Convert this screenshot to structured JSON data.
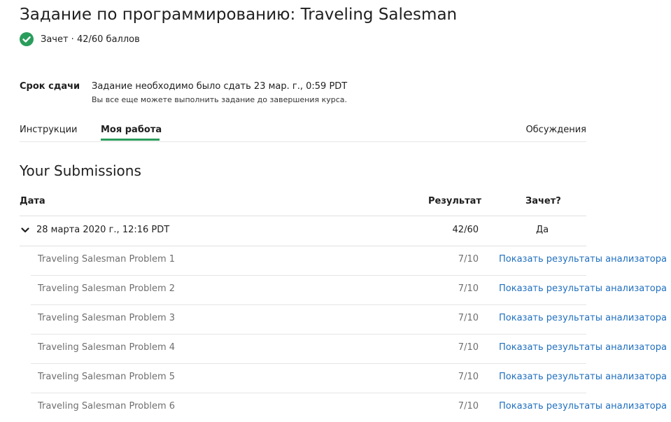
{
  "page_title": "Задание по программированию: Traveling Salesman",
  "status": {
    "text": "Зачет · 42/60 баллов",
    "color": "#2a9d5c"
  },
  "deadline": {
    "label": "Срок сдачи",
    "text": "Задание необходимо было сдать 23 мар. г., 0:59 PDT",
    "subtext": "Вы все еще можете выполнить задание до завершения курса."
  },
  "tabs": [
    {
      "label": "Инструкции",
      "active": false
    },
    {
      "label": "Моя работа",
      "active": true
    },
    {
      "label": "Обсуждения",
      "active": false
    }
  ],
  "submissions": {
    "title": "Your Submissions",
    "columns": {
      "date": "Дата",
      "result": "Результат",
      "passed": "Зачет?"
    },
    "summary": {
      "date": "28 марта 2020 г., 12:16 PDT",
      "score": "42/60",
      "passed": "Да"
    },
    "items": [
      {
        "name": "Traveling Salesman Problem 1",
        "score": "7/10",
        "link": "Показать результаты анализатора"
      },
      {
        "name": "Traveling Salesman Problem 2",
        "score": "7/10",
        "link": "Показать результаты анализатора"
      },
      {
        "name": "Traveling Salesman Problem 3",
        "score": "7/10",
        "link": "Показать результаты анализатора"
      },
      {
        "name": "Traveling Salesman Problem 4",
        "score": "7/10",
        "link": "Показать результаты анализатора"
      },
      {
        "name": "Traveling Salesman Problem 5",
        "score": "7/10",
        "link": "Показать результаты анализатора"
      },
      {
        "name": "Traveling Salesman Problem 6",
        "score": "7/10",
        "link": "Показать результаты анализатора"
      }
    ]
  }
}
